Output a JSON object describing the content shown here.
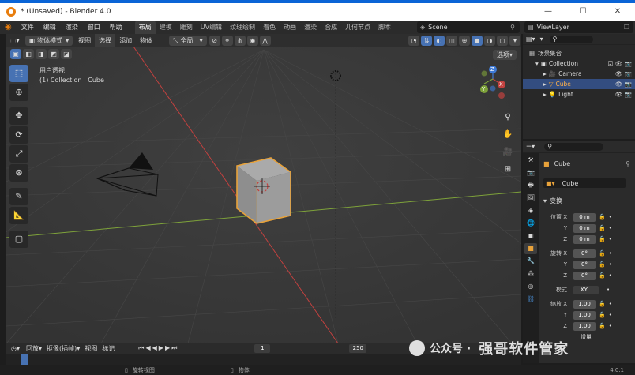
{
  "window": {
    "title": "* (Unsaved) - Blender 4.0",
    "minimize": "—",
    "maximize": "☐",
    "close": "✕"
  },
  "menu": {
    "items": [
      "文件",
      "编辑",
      "渲染",
      "窗口",
      "帮助"
    ],
    "workspaces": [
      "布局",
      "建模",
      "雕刻",
      "UV编辑",
      "纹理绘制",
      "着色",
      "动画",
      "渲染",
      "合成",
      "几何节点",
      "脚本"
    ],
    "active_workspace": "布局",
    "scene_label": "Scene",
    "viewlayer_label": "ViewLayer"
  },
  "viewport": {
    "mode": "物体模式",
    "menu": [
      "视图",
      "选择",
      "添加",
      "物体"
    ],
    "transform_orientation": "全局",
    "options_label": "选项",
    "view_name": "用户透视",
    "view_subtitle": "(1) Collection | Cube",
    "axes": {
      "x": "X",
      "y": "Y",
      "z": "Z"
    }
  },
  "outliner": {
    "root": "场景集合",
    "collection": "Collection",
    "objects": [
      "Camera",
      "Cube",
      "Light"
    ],
    "selected": "Cube"
  },
  "properties": {
    "object_name": "Cube",
    "data_name": "Cube",
    "section": "变换",
    "location_label": "位置 X",
    "rotation_label": "旋转 X",
    "scale_label": "缩放 X",
    "mode_label": "模式",
    "mode_value": "XY...",
    "y_label": "Y",
    "z_label": "Z",
    "location": [
      "0 m",
      "0 m",
      "0 m"
    ],
    "rotation": [
      "0°",
      "0°",
      "0°"
    ],
    "scale": [
      "1.00",
      "1.00",
      "1.00"
    ],
    "delta_label": "增量"
  },
  "timeline": {
    "playback": "回放",
    "keying": "抠像(插帧)",
    "view": "视图",
    "marker": "标记",
    "current_frame": "1",
    "end_frame": "250"
  },
  "status": {
    "rotate_view": "旋转视图",
    "object": "物体",
    "version": "4.0.1"
  },
  "watermark": {
    "brand": "强哥软件管家",
    "prefix": "公众号 ·"
  },
  "colors": {
    "accent": "#4772b3",
    "selected_outline": "#e8a23a",
    "x_axis": "#c2413f",
    "y_axis": "#7ea23a",
    "z_axis": "#3e7ad6"
  }
}
